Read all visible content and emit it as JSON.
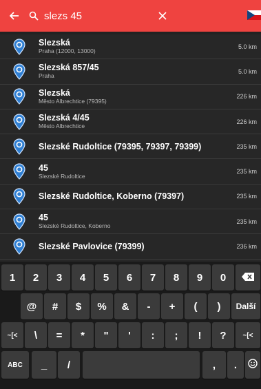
{
  "topbar": {
    "back_icon": "arrow-left-icon",
    "search_icon": "search-icon",
    "query": "slezs 45",
    "clear_icon": "close-icon",
    "flag_icon": "czech-flag-icon",
    "accent": "#ef4340"
  },
  "results": [
    {
      "name": "Slezská",
      "sub": "Praha (12000, 13000)",
      "distance": "5.0 km"
    },
    {
      "name": "Slezská 857/45",
      "sub": "Praha",
      "distance": "5.0 km"
    },
    {
      "name": "Slezská",
      "sub": "Město Albrechtice (79395)",
      "distance": "226 km"
    },
    {
      "name": "Slezská 4/45",
      "sub": "Město Albrechtice",
      "distance": "226 km"
    },
    {
      "name": "Slezské Rudoltice (79395, 79397, 79399)",
      "sub": "",
      "distance": "235 km"
    },
    {
      "name": "45",
      "sub": "Slezské Rudoltice",
      "distance": "235 km"
    },
    {
      "name": "Slezské Rudoltice, Koberno (79397)",
      "sub": "",
      "distance": "235 km"
    },
    {
      "name": "45",
      "sub": "Slezské Rudoltice, Koberno",
      "distance": "235 km"
    },
    {
      "name": "Slezské Pavlovice (79399)",
      "sub": "",
      "distance": "236 km"
    }
  ],
  "keyboard": {
    "row1": [
      "1",
      "2",
      "3",
      "4",
      "5",
      "6",
      "7",
      "8",
      "9",
      "0"
    ],
    "backspace_icon": "backspace-icon",
    "row2": [
      "@",
      "#",
      "$",
      "%",
      "&",
      "-",
      "+",
      "(",
      ")"
    ],
    "enter_label": "Další",
    "row3": [
      "~[<",
      "\\",
      "=",
      "*",
      "\"",
      "'",
      ":",
      ";",
      "!",
      "?",
      "~[<"
    ],
    "abc_label": "ABC",
    "underscore": "_",
    "slash": "/",
    "comma": ",",
    "period": ".",
    "emoji_icon": "smiley-icon"
  }
}
